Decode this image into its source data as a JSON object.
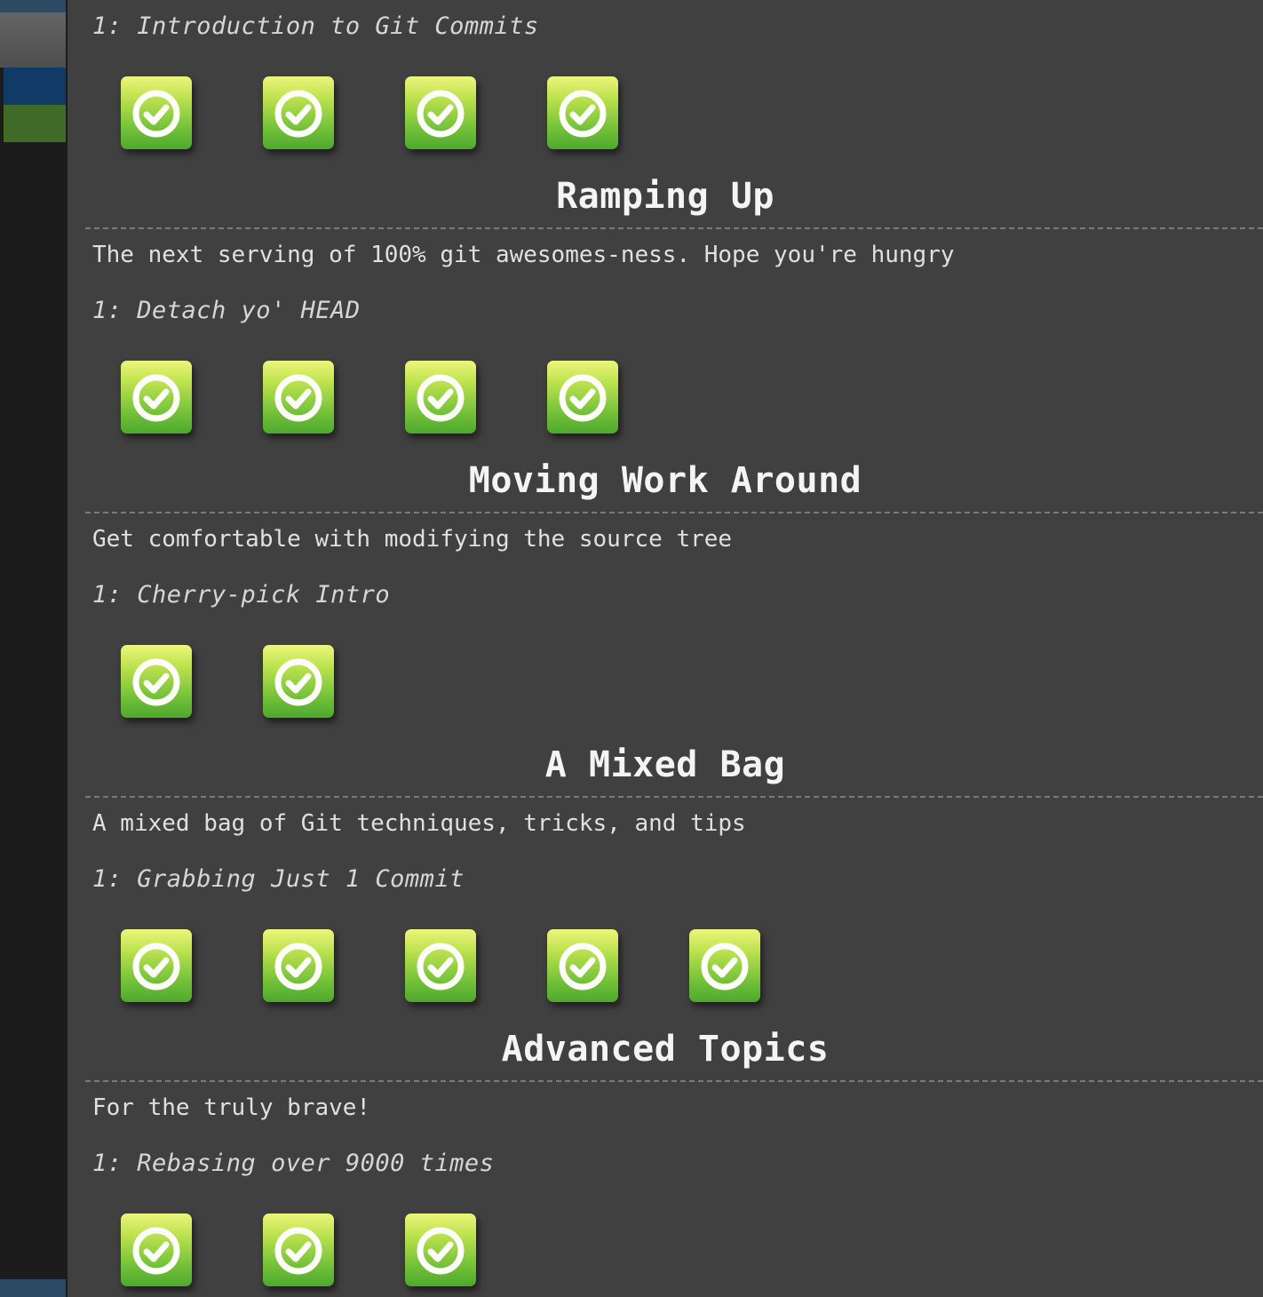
{
  "sidebar": {
    "colors": {
      "active_blue": "#123a66",
      "active_green": "#3f6a28",
      "background": "#1c1c1c"
    }
  },
  "theme": {
    "background": "#404040",
    "icon_gradient_top": "#eef57a",
    "icon_gradient_bottom": "#4ea82c",
    "divider": "#7a7a7a"
  },
  "sections": [
    {
      "title": "",
      "about": "",
      "levels": [
        {
          "name": "1: Introduction to Git Commits",
          "icon": "checkmark-icon",
          "completed": [
            true,
            true,
            true,
            true
          ]
        }
      ]
    },
    {
      "title": "Ramping Up",
      "about": "The next serving of 100% git awesomes-ness. Hope you're hungry",
      "levels": [
        {
          "name": "1: Detach yo' HEAD",
          "icon": "checkmark-icon",
          "completed": [
            true,
            true,
            true,
            true
          ]
        }
      ]
    },
    {
      "title": "Moving Work Around",
      "about": "Get comfortable with modifying the source tree",
      "levels": [
        {
          "name": "1: Cherry-pick Intro",
          "icon": "checkmark-icon",
          "completed": [
            true,
            true
          ]
        }
      ]
    },
    {
      "title": "A Mixed Bag",
      "about": "A mixed bag of Git techniques, tricks, and tips",
      "levels": [
        {
          "name": "1: Grabbing Just 1 Commit",
          "icon": "checkmark-icon",
          "completed": [
            true,
            true,
            true,
            true,
            true
          ]
        }
      ]
    },
    {
      "title": "Advanced Topics",
      "about": "For the truly brave!",
      "levels": [
        {
          "name": "1: Rebasing over 9000 times",
          "icon": "checkmark-icon",
          "completed": [
            true,
            true,
            true
          ]
        }
      ]
    }
  ]
}
